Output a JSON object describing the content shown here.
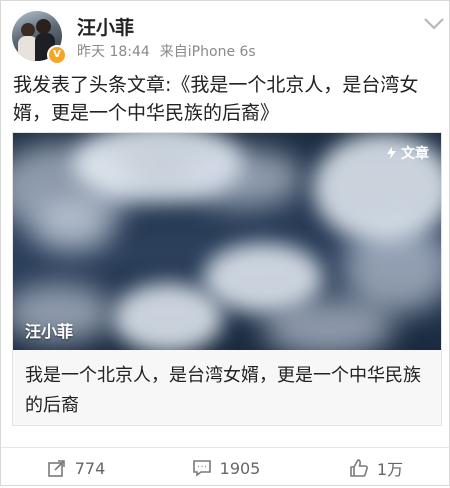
{
  "post": {
    "username": "汪小菲",
    "verified_badge": "V",
    "time": "昨天 18:44",
    "source": "来自iPhone 6s",
    "text": "我发表了头条文章:《我是一个北京人，是台湾女婿，更是一个中华民族的后裔》"
  },
  "article": {
    "tag_icon": "lightning-icon",
    "tag": "文章",
    "author": "汪小菲",
    "title": "我是一个北京人，是台湾女婿，更是一个中华民族的后裔"
  },
  "actions": {
    "repost_count": "774",
    "comment_count": "1905",
    "like_count": "1万"
  },
  "colors": {
    "meta_gray": "#8a8a8a",
    "badge": "#f6a623",
    "cover_sky": "#2c405c"
  }
}
